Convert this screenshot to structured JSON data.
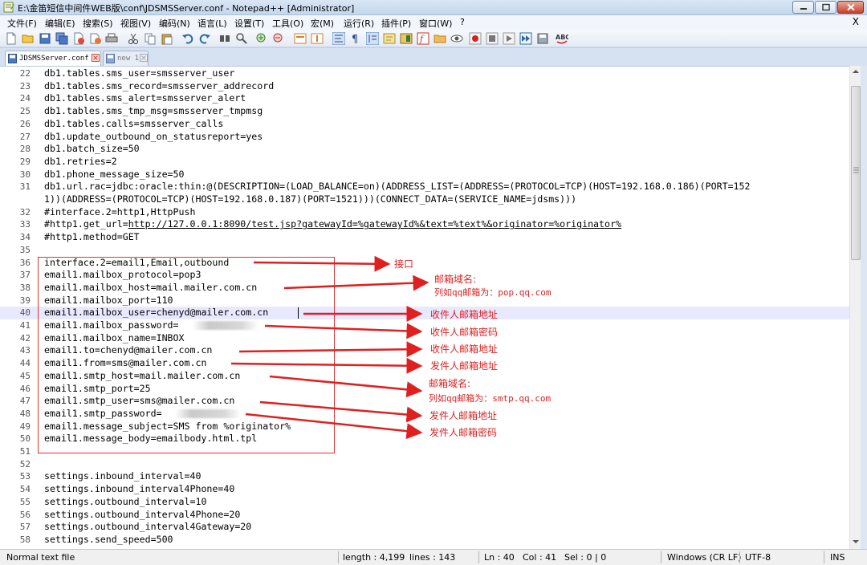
{
  "window": {
    "title": "E:\\金笛短信中间件WEB版\\conf\\JDSMSServer.conf - Notepad++ [Administrator]"
  },
  "menu": [
    {
      "label": "文件(F)"
    },
    {
      "label": "编辑(E)"
    },
    {
      "label": "搜索(S)"
    },
    {
      "label": "视图(V)"
    },
    {
      "label": "编码(N)"
    },
    {
      "label": "语言(L)"
    },
    {
      "label": "设置(T)"
    },
    {
      "label": "工具(O)"
    },
    {
      "label": "宏(M)"
    },
    {
      "label": "运行(R)"
    },
    {
      "label": "插件(P)"
    },
    {
      "label": "窗口(W)"
    },
    {
      "label": "?"
    }
  ],
  "menu_close": "X",
  "tabs": [
    {
      "label": "JDSMSServer.conf"
    },
    {
      "label": "new 1"
    }
  ],
  "editor": {
    "lines": [
      {
        "num": "22",
        "text": "db1.tables.sms_user=smsserver_user"
      },
      {
        "num": "23",
        "text": "db1.tables.sms_record=smsserver_addrecord"
      },
      {
        "num": "24",
        "text": "db1.tables.sms_alert=smsserver_alert"
      },
      {
        "num": "25",
        "text": "db1.tables.sms_tmp_msg=smsserver_tmpmsg"
      },
      {
        "num": "26",
        "text": "db1.tables.calls=smsserver_calls"
      },
      {
        "num": "27",
        "text": "db1.update_outbound_on_statusreport=yes"
      },
      {
        "num": "28",
        "text": "db1.batch_size=50"
      },
      {
        "num": "29",
        "text": "db1.retries=2"
      },
      {
        "num": "30",
        "text": "db1.phone_message_size=50"
      },
      {
        "num": "31",
        "text": "db1.url.rac=jdbc:oracle:thin:@(DESCRIPTION=(LOAD_BALANCE=on)(ADDRESS_LIST=(ADDRESS=(PROTOCOL=TCP)(HOST=192.168.0.186)(PORT=152"
      },
      {
        "num": "",
        "text": "1))(ADDRESS=(PROTOCOL=TCP)(HOST=192.168.0.187)(PORT=1521)))(CONNECT_DATA=(SERVICE_NAME=jdsms)))"
      },
      {
        "num": "32",
        "text": "#interface.2=http1,HttpPush"
      },
      {
        "num": "33",
        "text": "#http1.get_url=",
        "url": "http://127.0.0.1:8090/test.jsp?gatewayId=%gatewayId%&text=%text%&originator=%originator%"
      },
      {
        "num": "34",
        "text": "#http1.method=GET"
      },
      {
        "num": "35",
        "text": ""
      },
      {
        "num": "36",
        "text": "interface.2=email1,Email,outbound"
      },
      {
        "num": "37",
        "text": "email1.mailbox_protocol=pop3"
      },
      {
        "num": "38",
        "text": "email1.mailbox_host=mail.mailer.com.cn"
      },
      {
        "num": "39",
        "text": "email1.mailbox_port=110"
      },
      {
        "num": "40",
        "text": "email1.mailbox_user=chenyd@mailer.com.cn"
      },
      {
        "num": "41",
        "text": "email1.mailbox_password="
      },
      {
        "num": "42",
        "text": "email1.mailbox_name=INBOX"
      },
      {
        "num": "43",
        "text": "email1.to=chenyd@mailer.com.cn"
      },
      {
        "num": "44",
        "text": "email1.from=sms@mailer.com.cn"
      },
      {
        "num": "45",
        "text": "email1.smtp_host=mail.mailer.com.cn"
      },
      {
        "num": "46",
        "text": "email1.smtp_port=25"
      },
      {
        "num": "47",
        "text": "email1.smtp_user=sms@mailer.com.cn"
      },
      {
        "num": "48",
        "text": "email1.smtp_password="
      },
      {
        "num": "49",
        "text": "email1.message_subject=SMS from %originator%"
      },
      {
        "num": "50",
        "text": "email1.message_body=emailbody.html.tpl"
      },
      {
        "num": "51",
        "text": ""
      },
      {
        "num": "52",
        "text": ""
      },
      {
        "num": "53",
        "text": "settings.inbound_interval=40"
      },
      {
        "num": "54",
        "text": "settings.inbound_interval4Phone=40"
      },
      {
        "num": "55",
        "text": "settings.outbound_interval=10"
      },
      {
        "num": "56",
        "text": "settings.outbound_interval4Phone=20"
      },
      {
        "num": "57",
        "text": "settings.outbound_interval4Gateway=20"
      },
      {
        "num": "58",
        "text": "settings.send_speed=500"
      }
    ]
  },
  "annotations": {
    "interface": "接口",
    "incoming_domain": "邮箱域名:",
    "incoming_example": "列如qq邮箱为：pop.qq.com",
    "recv_address_1": "收件人邮箱地址",
    "recv_password": "收件人邮箱密码",
    "recv_address_2": "收件人邮箱地址",
    "sender_address_1": "发件人邮箱地址",
    "outgoing_domain": "邮箱域名:",
    "outgoing_example": "列如qq邮箱为：smtp.qq.com",
    "sender_address_2": "发件人邮箱地址",
    "sender_password": "发件人邮箱密码",
    "color": "#e02020"
  },
  "status": {
    "file_type": "Normal text file",
    "length": "length : 4,199",
    "lines": "lines : 143",
    "ln": "Ln : 40",
    "col": "Col : 41",
    "sel": "Sel : 0 | 0",
    "eol": "Windows (CR LF)",
    "encoding": "UTF-8",
    "mode": "INS"
  }
}
